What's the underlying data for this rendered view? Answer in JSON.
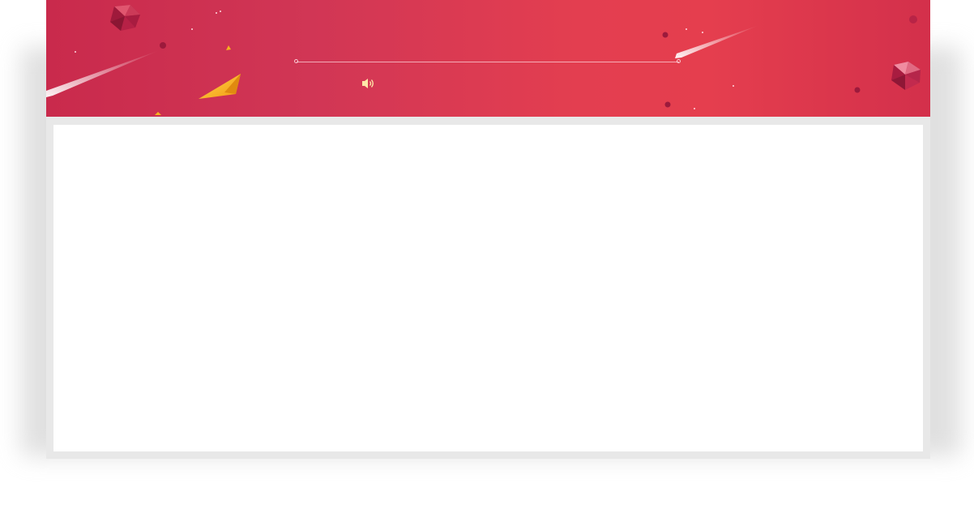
{
  "colors": {
    "banner_left": "#c92a4c",
    "banner_center": "#e53e4e",
    "banner_right": "#d3304b",
    "page_background": "#ffffff",
    "card_frame": "#e8e8e8",
    "content_panel": "#ffffff",
    "accent_gold": "#f5b21f"
  },
  "banner": {
    "decorations": [
      "gem-icon",
      "shooting-star-icon",
      "paper-plane-icon",
      "sparkle-icon"
    ]
  },
  "controls": {
    "sound_icon": "speaker-volume-icon"
  }
}
